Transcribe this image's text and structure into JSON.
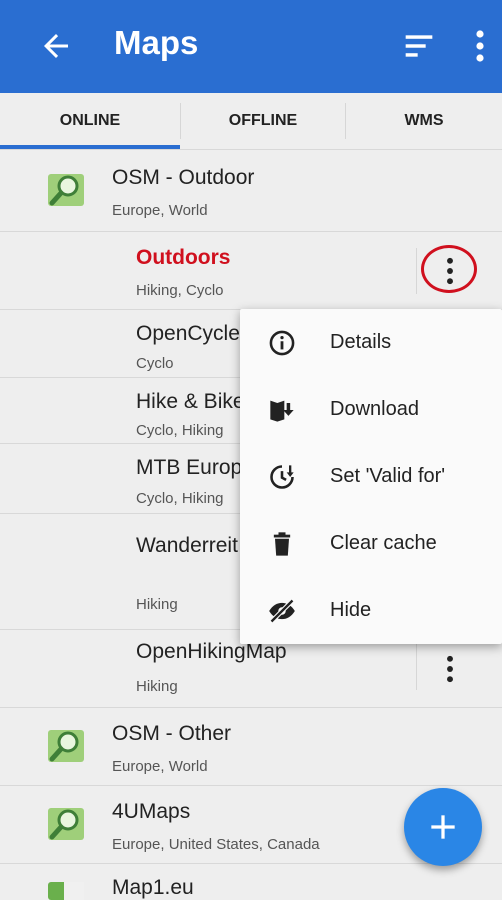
{
  "appbar": {
    "title": "Maps",
    "icons": [
      "back-arrow-icon",
      "sort-icon",
      "more-vert-icon"
    ],
    "color": "#2a6ed1"
  },
  "tabs": [
    {
      "label": "ONLINE",
      "selected": true
    },
    {
      "label": "OFFLINE"
    },
    {
      "label": "WMS"
    }
  ],
  "rows": [
    {
      "name": "OSM - Outdoor",
      "sub": "Europe, World"
    },
    {
      "name": "Outdoors",
      "sub": "Hiking, Cyclo"
    },
    {
      "name": "OpenCycle",
      "sub": "Cyclo"
    },
    {
      "name": "Hike & Bike",
      "sub": "Cyclo, Hiking"
    },
    {
      "name": "MTB Europ",
      "sub": "Cyclo, Hiking"
    },
    {
      "name": "Wanderreit",
      "sub": "Hiking"
    },
    {
      "name": "OpenHikingMap",
      "sub": "Hiking"
    },
    {
      "name": "OSM - Other",
      "sub": "Europe, World"
    },
    {
      "name": "4UMaps",
      "sub": "Europe, United States, Canada"
    },
    {
      "name": "Map1.eu"
    }
  ],
  "menu": [
    {
      "label": "Details",
      "icon": "info-icon"
    },
    {
      "label": "Download",
      "icon": "download-map-icon"
    },
    {
      "label": "Set 'Valid for'",
      "icon": "clock-update-icon"
    },
    {
      "label": "Clear cache",
      "icon": "trash-icon"
    },
    {
      "label": "Hide",
      "icon": "hide-eye-icon"
    }
  ],
  "fab": {
    "icon": "plus-icon",
    "color": "#2a86e6"
  },
  "colors": {
    "active_item": "#d0101e",
    "highlight_circle": "#d0101e"
  }
}
